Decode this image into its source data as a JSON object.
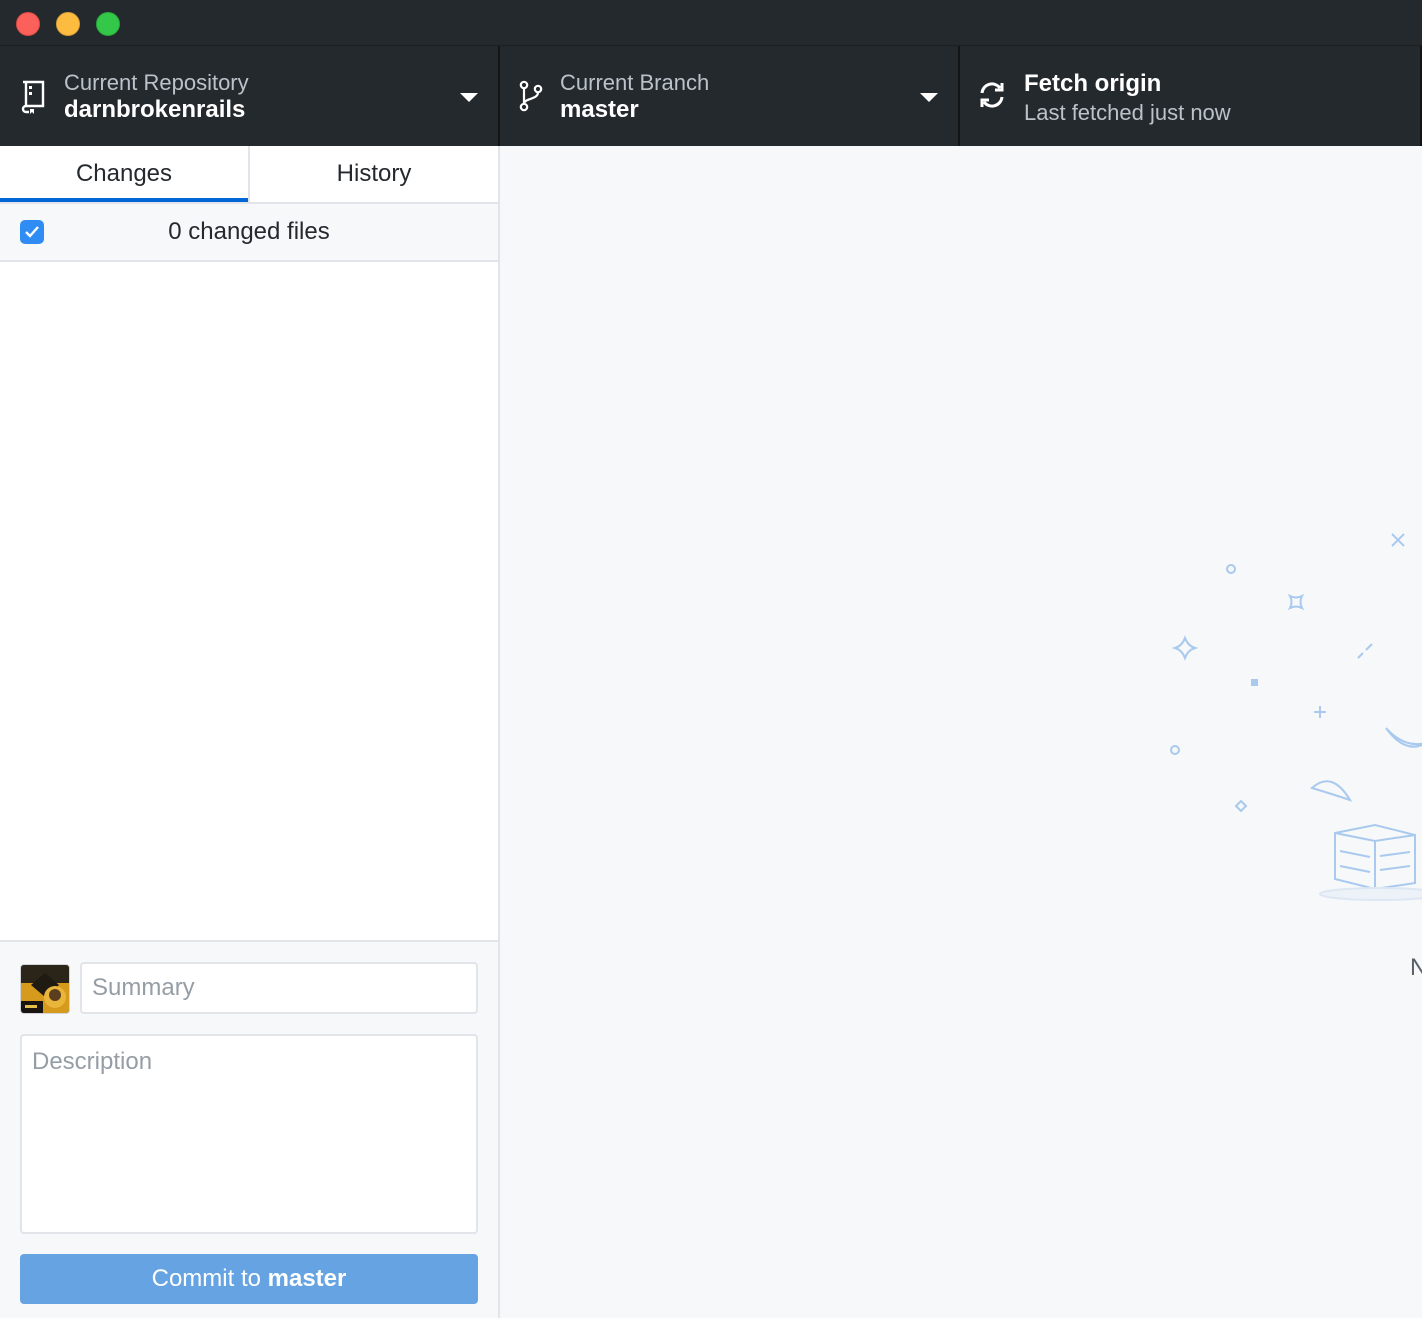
{
  "window": {
    "traffic_lights": [
      "close",
      "minimize",
      "maximize"
    ]
  },
  "toolbar": {
    "repository": {
      "title": "Current Repository",
      "description": "darnbrokenrails",
      "icon": "repo-icon"
    },
    "branch": {
      "title": "Current Branch",
      "description": "master",
      "icon": "git-branch-icon"
    },
    "fetch": {
      "title": "Fetch origin",
      "description": "Last fetched just now",
      "icon": "sync-icon"
    }
  },
  "sidebar": {
    "tabs": [
      {
        "label": "Changes",
        "selected": true
      },
      {
        "label": "History",
        "selected": false
      }
    ],
    "changes_header": {
      "checked": true,
      "label": "0 changed files"
    },
    "commit": {
      "summary_placeholder": "Summary",
      "description_placeholder": "Description",
      "button_prefix": "Commit to ",
      "button_branch": "master"
    }
  },
  "main": {
    "partial_text": "N"
  },
  "colors": {
    "toolbar_bg": "#24292e",
    "accent_blue": "#0366d6",
    "commit_button": "#66a3e2",
    "checkbox": "#2f8cf4"
  }
}
